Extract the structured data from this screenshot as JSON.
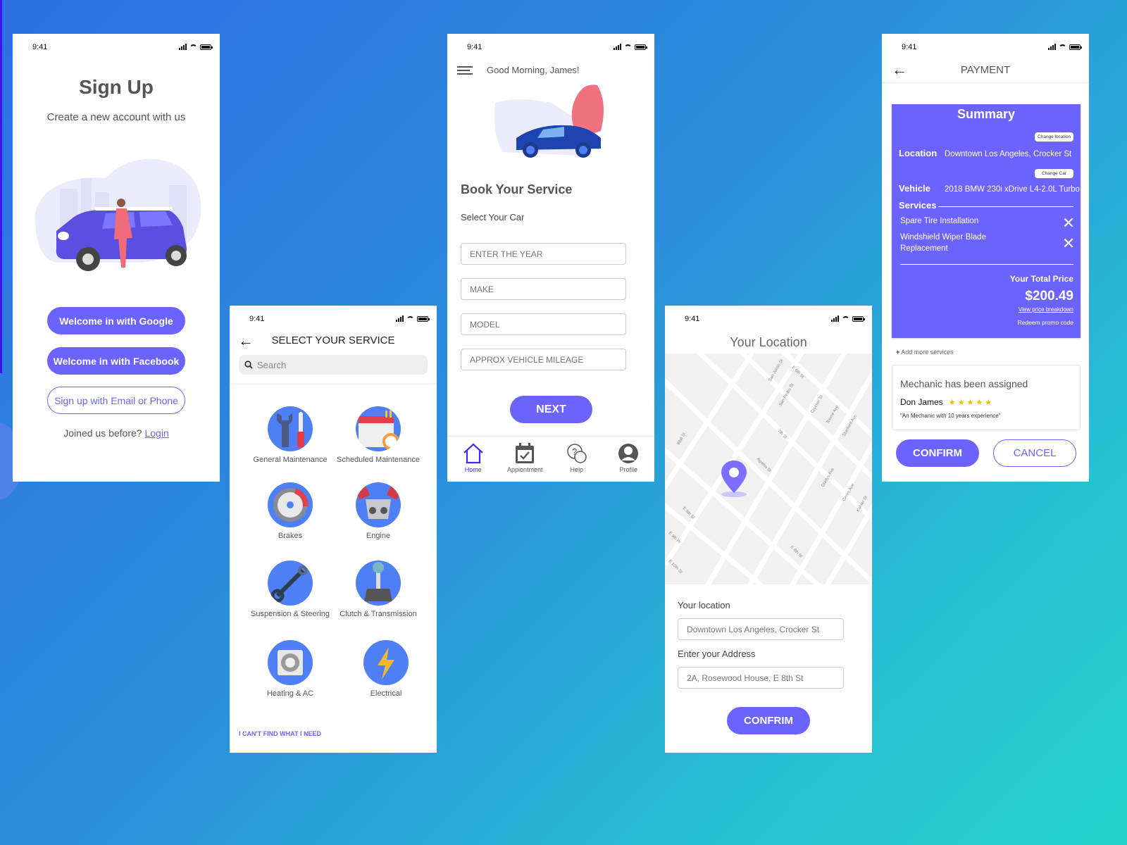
{
  "status_time": "9:41",
  "signup": {
    "title": "Sign Up",
    "subtitle": "Create a new account with us",
    "google_button": "Welcome in with Google",
    "facebook_button": "Welcome in with Facebook",
    "email_button": "Sign up with Email or Phone",
    "joined_text": "Joined us before?",
    "login_link": "Login"
  },
  "services": {
    "title": "SELECT YOUR SERVICE",
    "search_placeholder": "Search",
    "items": [
      {
        "label": "General Maintenance",
        "icon": "wrench-screwdriver-icon"
      },
      {
        "label": "Scheduled Maintenance",
        "icon": "calendar-clock-icon"
      },
      {
        "label": "Brakes",
        "icon": "brake-disc-icon"
      },
      {
        "label": "Engine",
        "icon": "engine-icon"
      },
      {
        "label": "Suspension & Steering",
        "icon": "shock-absorber-icon"
      },
      {
        "label": "Clutch & Transmission",
        "icon": "gear-shift-icon"
      },
      {
        "label": "Heating & AC",
        "icon": "fan-icon"
      },
      {
        "label": "Electrical",
        "icon": "lightning-icon"
      }
    ],
    "cant_find": "I CAN'T FIND WHAT I NEED"
  },
  "booking": {
    "greeting": "Good Morning, James!",
    "title": "Book Your Service",
    "select_car": "Select Your Car",
    "fields": [
      {
        "placeholder": "ENTER THE YEAR"
      },
      {
        "placeholder": "MAKE"
      },
      {
        "placeholder": "MODEL"
      },
      {
        "placeholder": "APPROX VEHICLE MILEAGE"
      }
    ],
    "next_button": "NEXT",
    "nav": [
      {
        "label": "Home",
        "icon": "home-icon",
        "active": true
      },
      {
        "label": "Appiontment",
        "icon": "calendar-check-icon",
        "active": false
      },
      {
        "label": "Help",
        "icon": "help-chat-icon",
        "active": false
      },
      {
        "label": "Profile",
        "icon": "profile-icon",
        "active": false
      }
    ]
  },
  "location": {
    "title": "Your Location",
    "map_streets": [
      "San Julian St",
      "E 6th St",
      "San Pedro St",
      "7th St",
      "Crocker St",
      "Towne Ave",
      "Stanford Ave",
      "Wall St",
      "Agatha St",
      "Gladys Ave",
      "Ceres Ave",
      "E 9th St",
      "E 9th Pl",
      "E 10th St",
      "E 8th St",
      "Kohler St"
    ],
    "location_label": "Your location",
    "location_value": "Downtown Los Angeles, Crocker St",
    "address_label": "Enter your Address",
    "address_value": "2A, Rosewood House, E 8th St",
    "confirm_button": "CONFRIM"
  },
  "payment": {
    "title": "PAYMENT",
    "summary_title": "Summary",
    "change_location": "Change location",
    "location_label": "Location",
    "location_value": "Downtown Los Angeles, Crocker St",
    "change_car": "Change Car",
    "vehicle_label": "Vehicle",
    "vehicle_value": "2018 BMW 230i xDrive L4-2.0L Turbo",
    "services_label": "Services",
    "services": [
      "Spare Tire Installation",
      "Windshield Wiper Blade Replacement"
    ],
    "total_label": "Your Total Price",
    "total_value": "$200.49",
    "price_breakdown": "View price breakdown",
    "promo": "Redeem promo code",
    "add_more": "Add more services",
    "mechanic_title": "Mechanic has been assigned",
    "mechanic_name": "Don James",
    "mechanic_rating": 5,
    "mechanic_rating_max": 5,
    "mechanic_quote": "\"An Mechanic with 10 years experience\"",
    "confirm_button": "CONFIRM",
    "cancel_button": "CANCEL"
  },
  "colors": {
    "accent": "#6c63ff",
    "icon_bg": "#4e7ff5",
    "star": "#f5b800",
    "active_nav": "#3d2bf0"
  }
}
